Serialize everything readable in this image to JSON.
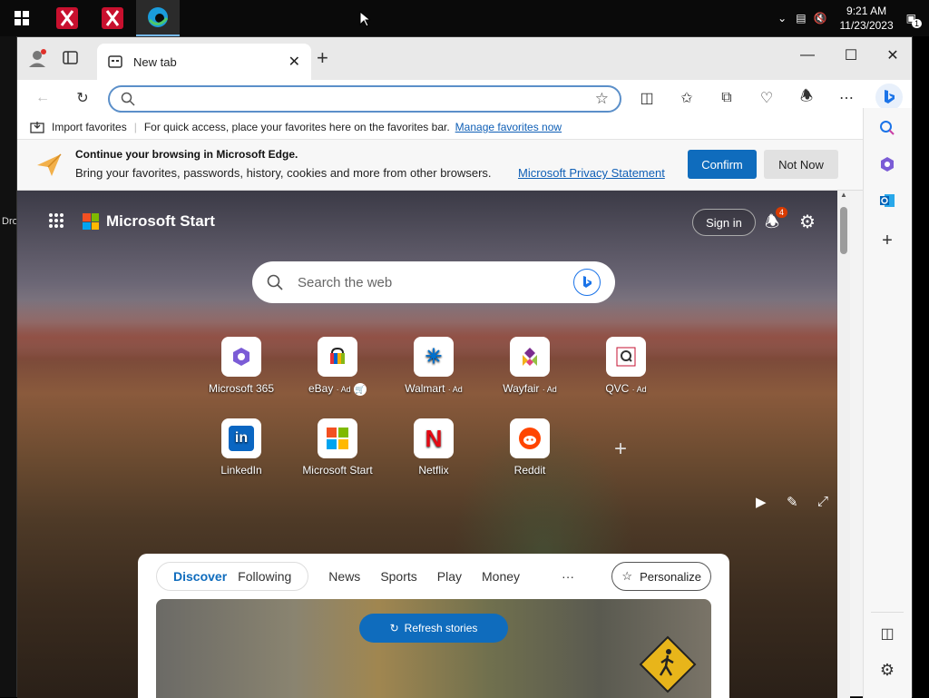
{
  "taskbar": {
    "time": "9:21 AM",
    "date": "11/23/2023",
    "notif_count": "1"
  },
  "desktop": {
    "partial_icon_text": "Dro"
  },
  "browser": {
    "tab_title": "New tab",
    "address_value": "",
    "favorites_bar": {
      "import_label": "Import favorites",
      "hint": "For quick access, place your favorites here on the favorites bar.",
      "manage_link": "Manage favorites now"
    },
    "infobar": {
      "title": "Continue your browsing in Microsoft Edge.",
      "body": "Bring your favorites, passwords, history, cookies and more from other browsers.",
      "privacy_link": "Microsoft Privacy Statement",
      "confirm": "Confirm",
      "not_now": "Not Now"
    }
  },
  "page": {
    "brand": "Microsoft Start",
    "sign_in": "Sign in",
    "notification_badge": "4",
    "search_placeholder": "Search the web",
    "tiles": [
      {
        "label": "Microsoft 365",
        "ad": ""
      },
      {
        "label": "eBay",
        "ad": "· Ad"
      },
      {
        "label": "Walmart",
        "ad": "· Ad"
      },
      {
        "label": "Wayfair",
        "ad": "· Ad"
      },
      {
        "label": "QVC",
        "ad": "· Ad"
      },
      {
        "label": "LinkedIn",
        "ad": ""
      },
      {
        "label": "Microsoft Start",
        "ad": ""
      },
      {
        "label": "Netflix",
        "ad": ""
      },
      {
        "label": "Reddit",
        "ad": ""
      }
    ],
    "feed": {
      "tabs": [
        "Discover",
        "Following"
      ],
      "nav": [
        "News",
        "Sports",
        "Play",
        "Money"
      ],
      "more": "···",
      "personalize": "Personalize",
      "refresh": "Refresh stories"
    }
  },
  "colors": {
    "accent": "#0f6cbd",
    "link": "#0f5fb6"
  }
}
